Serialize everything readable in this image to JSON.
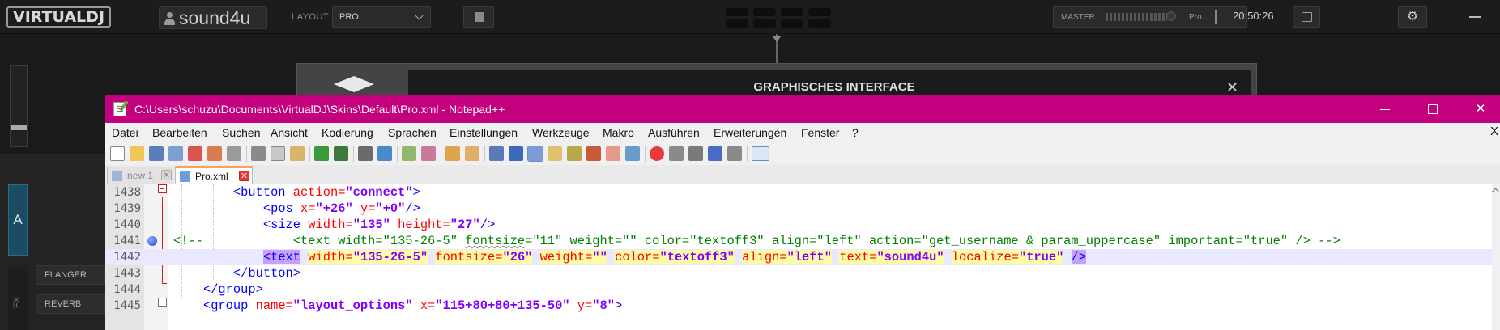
{
  "vdj": {
    "logo": "VIRTUALDJ",
    "username": "sound4u",
    "layout_label": "LAYOUT",
    "layout_value": "PRO",
    "master_label": "MASTER",
    "master_profile": "Pro...",
    "clock": "20:50:26",
    "deck_label": "A",
    "fx_label": "FX",
    "fx_buttons": [
      "FLANGER",
      "REVERB"
    ],
    "dialog_title": "GRAPHISCHES INTERFACE",
    "dialog_close": "✕"
  },
  "notepad": {
    "title": "C:\\Users\\schuzu\\Documents\\VirtualDJ\\Skins\\Default\\Pro.xml - Notepad++",
    "minimize": "",
    "maximize": "",
    "close": "✕",
    "menu": [
      "Datei",
      "Bearbeiten",
      "Suchen",
      "Ansicht",
      "Kodierung",
      "Sprachen",
      "Einstellungen",
      "Werkzeuge",
      "Makro",
      "Ausführen",
      "Erweiterungen",
      "Fenster",
      "?"
    ],
    "menu_close": "X",
    "tabs": [
      {
        "label": "new 1",
        "close": "✕"
      },
      {
        "label": "Pro.xml",
        "close": "✕"
      }
    ],
    "lines": [
      "1438",
      "1439",
      "1440",
      "1441",
      "1442",
      "1443",
      "1444",
      "1445"
    ],
    "code": {
      "l1438": {
        "indent": "        ",
        "open": "<button",
        "a1": " action=",
        "v1": "\"connect\"",
        "close": ">"
      },
      "l1439": {
        "indent": "            ",
        "open": "<pos",
        "a1": " x=",
        "v1": "\"+26\"",
        "a2": " y=",
        "v2": "\"+0\"",
        "close": "/>"
      },
      "l1440": {
        "indent": "            ",
        "open": "<size",
        "a1": " width=",
        "v1": "\"135\"",
        "a2": " height=",
        "v2": "\"27\"",
        "close": "/>"
      },
      "l1441": {
        "pre": "<!--            <text width=\"135-26-5\" ",
        "squig": "fontsize",
        "post": "=\"11\" weight=\"\" color=\"textoff3\" align=\"left\" action=\"get_username & param_uppercase\" important=\"true\" /> -->"
      },
      "l1442": {
        "indent": "            ",
        "open": "<text",
        "a1": "width",
        "v1": "\"135-26-5\"",
        "a2": "fontsize",
        "v2": "\"26\"",
        "a3": "weight",
        "v3": "\"\"",
        "a4": "color",
        "v4": "\"textoff3\"",
        "a5": "align",
        "v5": "\"left\"",
        "a6": "text",
        "v6": "\"sound4u\"",
        "a7": "localize",
        "v7": "\"true\"",
        "close": "/>",
        "eq": "="
      },
      "l1443": {
        "indent": "        ",
        "tag": "</button>"
      },
      "l1444": {
        "indent": "    ",
        "tag": "</group>"
      },
      "l1445": {
        "indent": "    ",
        "open": "<group",
        "a1": " name=",
        "v1": "\"layout_options\"",
        "a2": " x=",
        "v2": "\"115+80+80+135-50\"",
        "a3": " y=",
        "v3": "\"8\"",
        "close": ">"
      }
    }
  },
  "colors": {
    "titlebar": "#c3007e",
    "tag": "#0000ff",
    "attr": "#ff0000",
    "string": "#8000ff",
    "comment": "#008000",
    "current_line": "#e8e8ff",
    "deck_a": "#1c4c63"
  },
  "icons": [
    "person-icon",
    "chevron-down-icon",
    "cube-icon",
    "calendar-icon",
    "gear-icon",
    "minimize-icon",
    "mortarboard-icon",
    "notepad-app-icon",
    "floppy-icon",
    "bookmark-icon",
    "fold-icon",
    "scroll-up-icon"
  ]
}
